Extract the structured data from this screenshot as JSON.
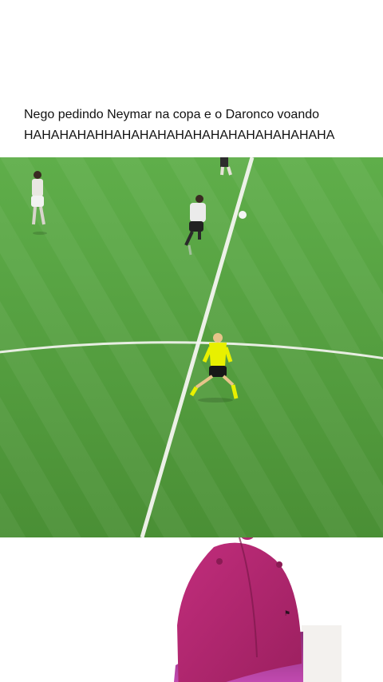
{
  "caption": {
    "line1": "Nego pedindo Neymar na copa e o Daronco voando",
    "line2": "HAHAHAHAHHAHAHAHAHAHAHAHAHAHAHAHAHA"
  },
  "colors": {
    "pitch_light": "#5ea847",
    "pitch_dark": "#4b9136",
    "referee_shirt": "#e8f000",
    "cap": "#b3256f"
  },
  "icons": {
    "cap": "baseball-cap-icon"
  }
}
